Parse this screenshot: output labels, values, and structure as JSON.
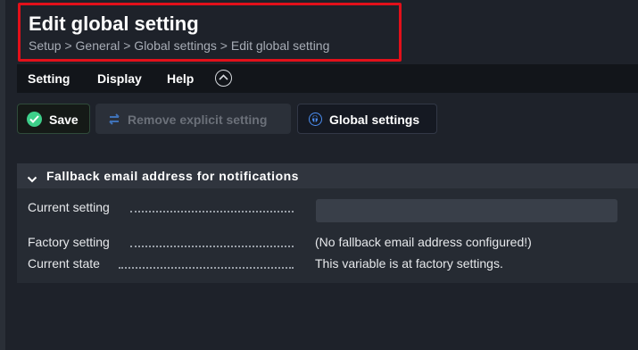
{
  "header": {
    "title": "Edit global setting",
    "breadcrumb": "Setup > General > Global settings > Edit global setting"
  },
  "menubar": {
    "items": [
      {
        "label": "Setting"
      },
      {
        "label": "Display"
      },
      {
        "label": "Help"
      }
    ],
    "toggle_icon": "chevron-up-icon"
  },
  "toolbar": {
    "save_label": "Save",
    "remove_label": "Remove explicit setting",
    "global_label": "Global settings"
  },
  "section": {
    "title": "Fallback email address for notifications",
    "rows": [
      {
        "label": "Current setting",
        "value": ""
      },
      {
        "label": "Factory setting",
        "value": "(No fallback email address configured!)"
      },
      {
        "label": "Current state",
        "value": "This variable is at factory settings."
      }
    ]
  },
  "colors": {
    "highlight_border": "#e2101a",
    "save_accent": "#3dcf8a",
    "global_accent": "#4b8df0",
    "background": "#1e222a"
  }
}
